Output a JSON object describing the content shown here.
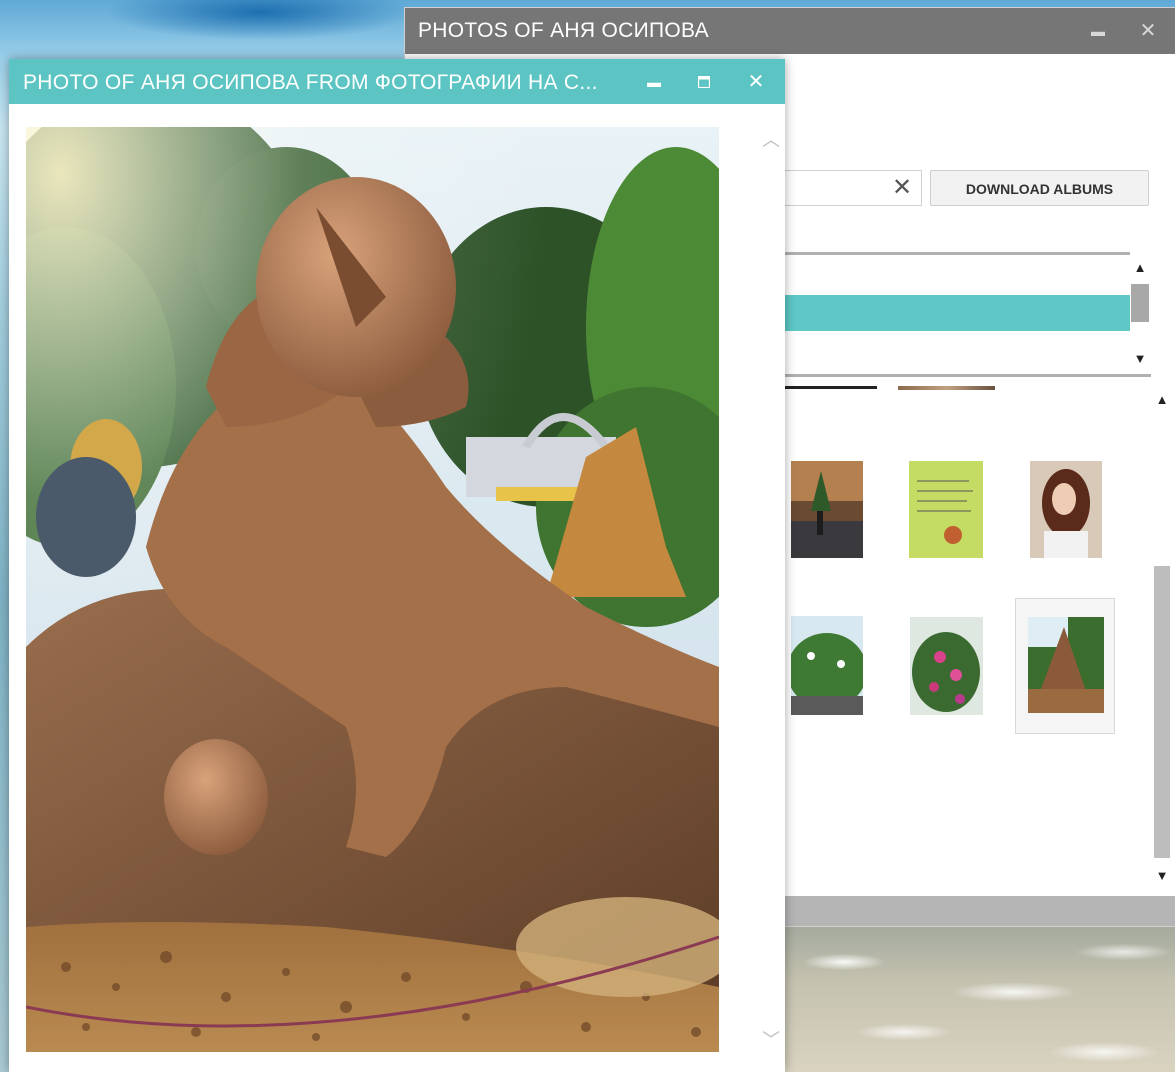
{
  "background_window": {
    "title": "PHOTOS OF АНЯ ОСИПОВА",
    "minimize_glyph": "▬",
    "close_glyph": "✕",
    "download_button_label": "DOWNLOAD ALBUMS",
    "clear_glyph": "✕",
    "scroll_up_glyph": "▲",
    "scroll_down_glyph": "▼"
  },
  "photo_window": {
    "title": "PHOTO OF АНЯ ОСИПОВА FROM ФОТОГРАФИИ НА С...",
    "minimize_glyph": "▬",
    "maximize_glyph": "🗖",
    "close_glyph": "✕",
    "scroll_up_glyph": "︿",
    "scroll_down_glyph": "﹀"
  },
  "colors": {
    "accent_teal": "#5cc5c3",
    "titlebar_gray": "#767676"
  },
  "icons": [
    "minimize-icon",
    "maximize-icon",
    "close-icon",
    "clear-search-icon",
    "scroll-up-icon",
    "scroll-down-icon"
  ]
}
